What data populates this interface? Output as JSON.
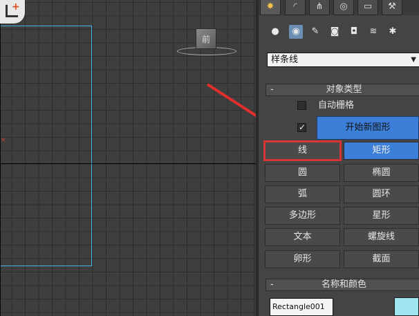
{
  "viewport": {
    "viewcube_label": "前",
    "corner_icon": "viewport-menu-icon"
  },
  "command_panel": {
    "tabs": [
      {
        "name": "create",
        "icon": "sun-icon"
      },
      {
        "name": "modify",
        "icon": "curve-icon"
      },
      {
        "name": "hierarchy",
        "icon": "hierarchy-icon"
      },
      {
        "name": "motion",
        "icon": "motion-icon"
      },
      {
        "name": "display",
        "icon": "monitor-icon"
      },
      {
        "name": "utilities",
        "icon": "hammer-icon"
      }
    ],
    "category_icons": [
      "sphere-icon",
      "shapes-icon",
      "light-icon",
      "camera-icon",
      "helper-icon",
      "spacewarp-icon",
      "systems-icon"
    ],
    "subcategory_dropdown": {
      "value": "样条线"
    },
    "object_type_rollout": {
      "title": "对象类型",
      "collapse_symbol": "-",
      "auto_grid_label": "自动栅格",
      "auto_grid_checked": false,
      "start_new_shape_label": "开始新图形",
      "start_new_shape_checked": true,
      "buttons": [
        [
          "线",
          "矩形"
        ],
        [
          "圆",
          "椭圆"
        ],
        [
          "弧",
          "圆环"
        ],
        [
          "多边形",
          "星形"
        ],
        [
          "文本",
          "螺旋线"
        ],
        [
          "卵形",
          "截面"
        ]
      ],
      "active_button": "矩形",
      "highlighted_button": "线"
    },
    "name_color_rollout": {
      "title": "名称和颜色",
      "collapse_symbol": "-",
      "name_value": "Rectangle001",
      "color": "#9fe5f0"
    }
  },
  "colors": {
    "accent_blue": "#3c7fd8",
    "highlight_red": "#d93333",
    "shape_outline": "#45b5e8"
  }
}
